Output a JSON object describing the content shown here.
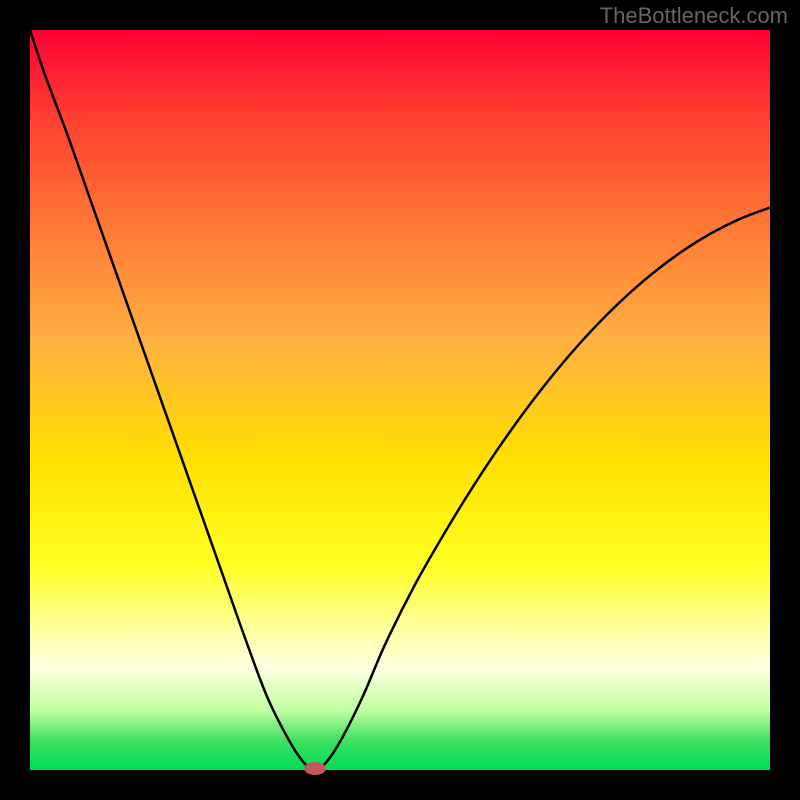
{
  "attribution": "TheBottleneck.com",
  "chart_data": {
    "type": "line",
    "title": "",
    "xlabel": "",
    "ylabel": "",
    "xlim": [
      0,
      100
    ],
    "ylim": [
      0,
      100
    ],
    "x": [
      0,
      2,
      5,
      8,
      11,
      14,
      17,
      20,
      23,
      26,
      29,
      32,
      35,
      37,
      38.5,
      40,
      42,
      45,
      48,
      52,
      56,
      60,
      64,
      68,
      72,
      76,
      80,
      84,
      88,
      92,
      96,
      100
    ],
    "values": [
      100,
      94,
      86,
      77.5,
      69,
      60.5,
      52,
      43.5,
      35,
      26.5,
      18,
      10,
      4,
      1,
      0,
      1,
      4,
      10,
      17,
      25,
      32,
      38.5,
      44.5,
      50,
      55,
      59.5,
      63.5,
      67,
      70,
      72.5,
      74.5,
      76
    ],
    "minimum": {
      "x": 38.5,
      "y": 0
    },
    "gradient_colors": {
      "top": "#ff0033",
      "mid": "#ffff20",
      "bottom": "#00dd55"
    },
    "background_meaning": "red=high bottleneck, green=low bottleneck"
  },
  "marker": {
    "x_pct": 38.5,
    "y_pct": 0
  }
}
